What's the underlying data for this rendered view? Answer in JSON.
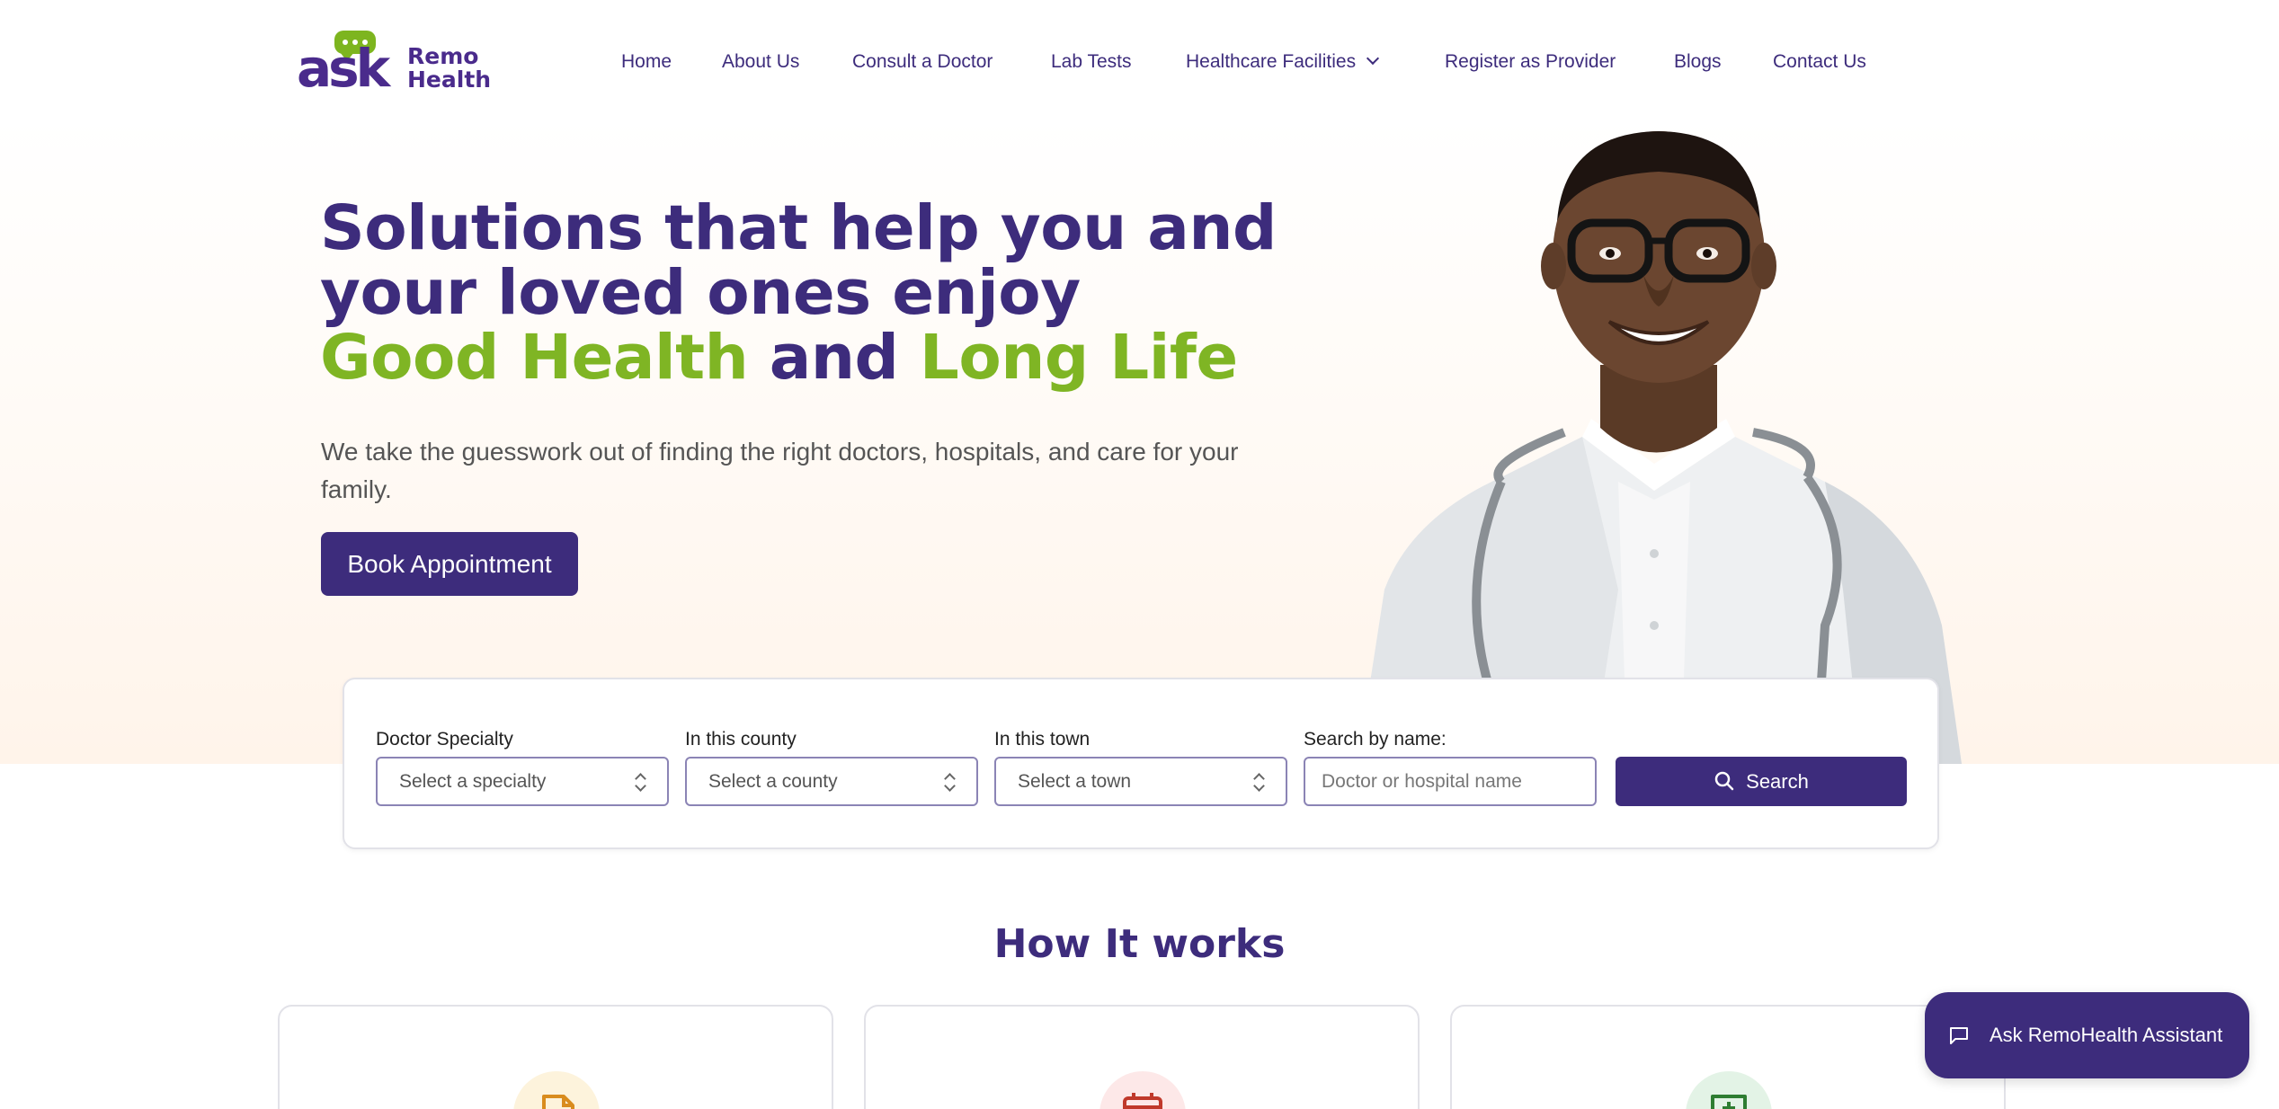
{
  "brand": {
    "logo_ask": "ask",
    "logo_remo": "Remo",
    "logo_health": "Health",
    "colors": {
      "primary": "#3d2c7c",
      "accent_green": "#7fb524",
      "hero_bg": "#fff4ea"
    }
  },
  "nav": {
    "items": [
      {
        "label": "Home"
      },
      {
        "label": "About Us"
      },
      {
        "label": "Consult a Doctor"
      },
      {
        "label": "Lab Tests"
      },
      {
        "label": "Healthcare Facilities",
        "has_dropdown": true
      },
      {
        "label": "Register as Provider"
      },
      {
        "label": "Blogs"
      },
      {
        "label": "Contact Us"
      }
    ]
  },
  "hero": {
    "title_line1": "Solutions that help you and",
    "title_line2": "your loved ones enjoy",
    "title_green1": "Good Health",
    "title_and": "and",
    "title_green2": "Long Life",
    "subtitle": "We take the guesswork out of finding the right doctors, hospitals, and care for your family.",
    "cta_label": "Book Appointment"
  },
  "search": {
    "specialty_label": "Doctor Specialty",
    "specialty_value": "Select a specialty",
    "county_label": "In this county",
    "county_value": "Select a county",
    "town_label": "In this town",
    "town_value": "Select a town",
    "name_label": "Search by name:",
    "name_placeholder": "Doctor or hospital name",
    "button_label": "Search"
  },
  "how_it_works": {
    "title": "How It works",
    "cards": [
      {
        "icon": "document-icon"
      },
      {
        "icon": "calendar-icon"
      },
      {
        "icon": "medical-chat-icon"
      }
    ]
  },
  "assistant": {
    "label": "Ask RemoHealth Assistant",
    "icon": "chat-icon"
  }
}
